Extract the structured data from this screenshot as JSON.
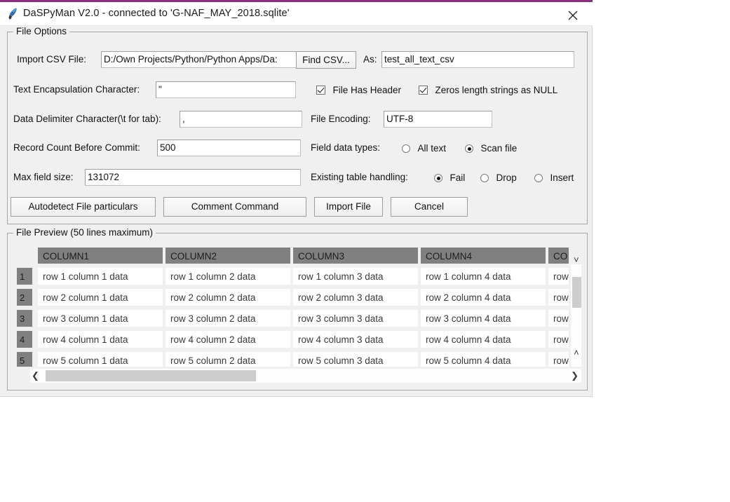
{
  "window": {
    "title": "DaSPyMan V2.0 - connected to 'G-NAF_MAY_2018.sqlite'",
    "app_icon": "feather-pen-icon",
    "close_icon": "close-icon",
    "accent_color": "#8b2f7f"
  },
  "file_options": {
    "group_title": "File Options",
    "import_csv_label": "Import CSV File:",
    "import_csv_value": "D:/Own Projects/Python/Python Apps/Da:",
    "find_csv_button": "Find CSV...",
    "as_label": "As:",
    "as_value": "test_all_text_csv",
    "text_encapsulation_label": "Text Encapsulation Character:",
    "text_encapsulation_value": "\"",
    "file_has_header_label": "File Has Header",
    "file_has_header_checked": true,
    "zero_length_null_label": "Zeros length strings as NULL",
    "zero_length_null_checked": true,
    "delimiter_label": "Data Delimiter Character(\\t for tab):",
    "delimiter_value": ",",
    "file_encoding_label": "File Encoding:",
    "file_encoding_value": "UTF-8",
    "record_count_label": "Record Count Before Commit:",
    "record_count_value": "500",
    "field_data_types_label": "Field data types:",
    "field_data_types_options": [
      "All text",
      "Scan file"
    ],
    "field_data_types_selected": "Scan file",
    "max_field_size_label": "Max field size:",
    "max_field_size_value": "131072",
    "existing_table_label": "Existing table handling:",
    "existing_table_options": [
      "Fail",
      "Drop",
      "Insert"
    ],
    "existing_table_selected": "Fail",
    "buttons": {
      "autodetect": "Autodetect File particulars",
      "comment": "Comment Command",
      "import": "Import File",
      "cancel": "Cancel"
    }
  },
  "file_preview": {
    "group_title": "File Preview (50 lines maximum)",
    "columns": [
      "COLUMN1",
      "COLUMN2",
      "COLUMN3",
      "COLUMN4",
      "CO"
    ],
    "row_numbers": [
      "1",
      "2",
      "3",
      "4",
      "5"
    ],
    "rows": [
      [
        "row 1 column 1 data",
        "row 1 column 2 data",
        "row 1 column 3 data",
        "row 1 column 4 data",
        "row"
      ],
      [
        "row 2 column 1 data",
        "row 2 column 2 data",
        "row 2 column 3 data",
        "row 2 column 4 data",
        "row"
      ],
      [
        "row 3 column 1 data",
        "row 3 column 2 data",
        "row 3 column 3 data",
        "row 3 column 4 data",
        "row"
      ],
      [
        "row 4 column 1 data",
        "row 4 column 2 data",
        "row 4 column 3 data",
        "row 4 column 4 data",
        "row"
      ],
      [
        "row 5 column 1 data",
        "row 5 column 2 data",
        "row 5 column 3 data",
        "row 5 column 4 data",
        "row"
      ]
    ],
    "scroll_up_icon": "chevron-up-icon",
    "scroll_down_icon": "chevron-down-icon",
    "scroll_left_icon": "chevron-left-icon",
    "scroll_right_icon": "chevron-right-icon"
  }
}
